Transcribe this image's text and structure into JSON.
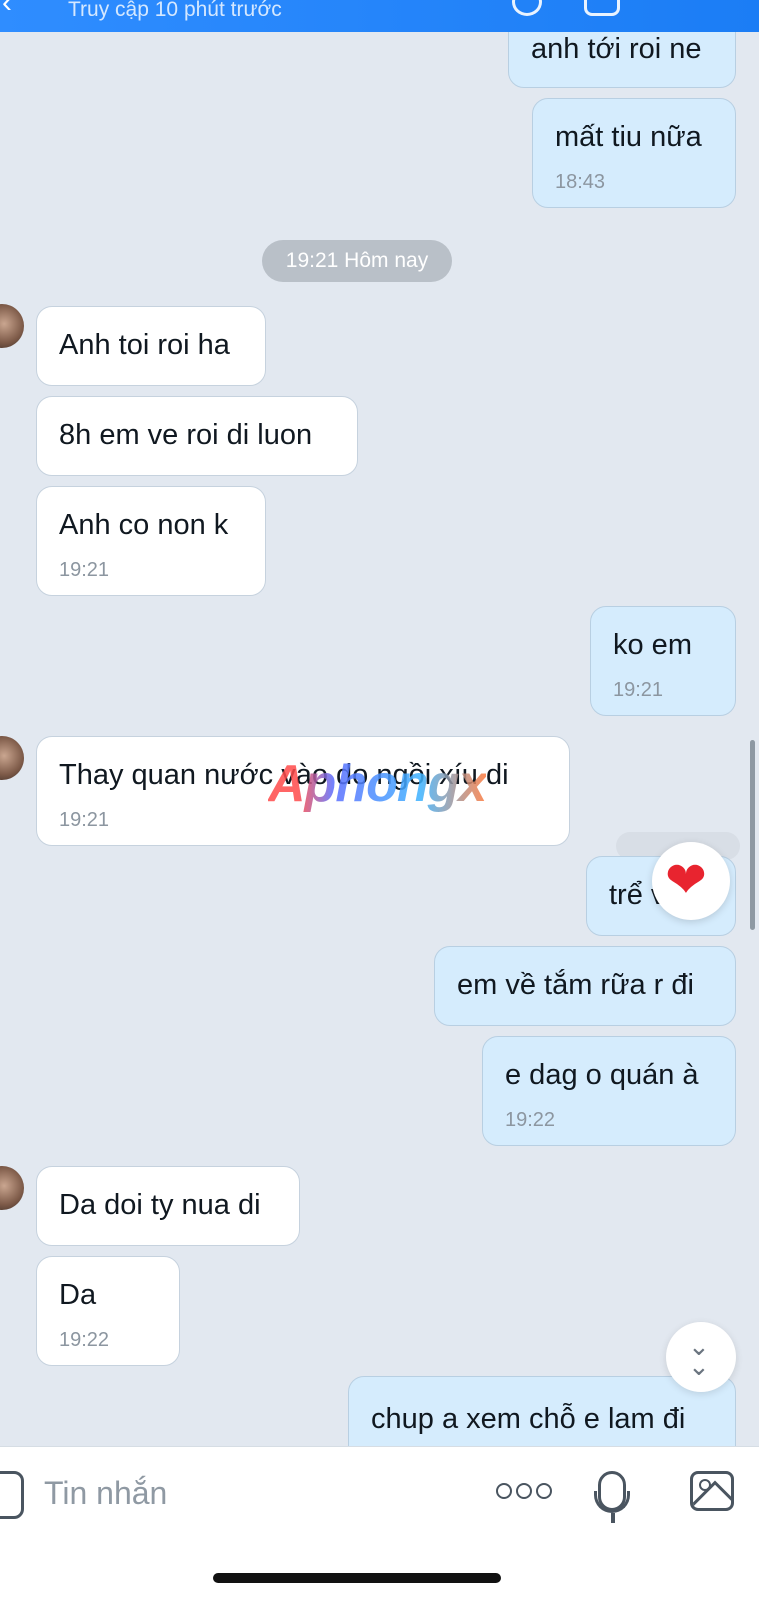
{
  "header": {
    "back_icon": "chevron-left-icon",
    "status": "Truy cập 10 phút trước"
  },
  "date_separator": "19:21 Hôm nay",
  "messages": [
    {
      "side": "out",
      "text": "anh tới roi ne",
      "time": ""
    },
    {
      "side": "out",
      "text": "mất tiu nữa",
      "time": "18:43"
    },
    {
      "side": "in",
      "text": "Anh toi roi ha",
      "time": ""
    },
    {
      "side": "in",
      "text": "8h em ve roi di luon",
      "time": ""
    },
    {
      "side": "in",
      "text": "Anh co non k",
      "time": "19:21"
    },
    {
      "side": "out",
      "text": "ko em",
      "time": "19:21"
    },
    {
      "side": "in",
      "text": "Thay quan nước vào do ngồi xíu di",
      "time": "19:21"
    },
    {
      "side": "out",
      "text": "trể vậy",
      "time": ""
    },
    {
      "side": "out",
      "text": "em về tắm rữa r đi",
      "time": ""
    },
    {
      "side": "out",
      "text": "e dag o quán à",
      "time": "19:22"
    },
    {
      "side": "in",
      "text": "Da doi ty nua di",
      "time": ""
    },
    {
      "side": "in",
      "text": "Da",
      "time": "19:22"
    },
    {
      "side": "out",
      "text": "chup a xem chỗ e lam đi",
      "time": ""
    }
  ],
  "reaction": {
    "icon": "heart-icon",
    "glyph": "❤",
    "color": "#e8242f"
  },
  "watermark": "Aphongx",
  "composer": {
    "placeholder": "Tin nhắn",
    "icons": [
      "sticker-icon",
      "more-icon",
      "mic-icon",
      "image-icon"
    ]
  },
  "colors": {
    "header": "#1b7df5",
    "incoming_bubble": "#ffffff",
    "outgoing_bubble": "#d5ecfd",
    "background": "#e2e8f0"
  }
}
